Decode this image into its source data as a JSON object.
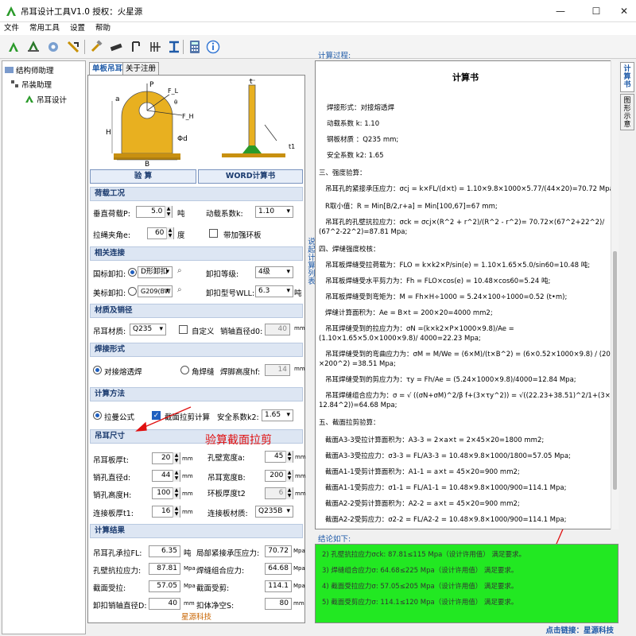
{
  "window": {
    "title": "吊耳设计工具V1.0 授权：火星源",
    "minimize": "—",
    "maximize": "☐",
    "close": "✕"
  },
  "menu": [
    "文件",
    "常用工具",
    "设置",
    "帮助"
  ],
  "tree": {
    "root": "结构师助理",
    "child": "吊装助理",
    "leaf": "吊耳设计"
  },
  "left_tabs": {
    "single": "单板吊耳",
    "about": "关于注册"
  },
  "buttons": {
    "check": "验    算",
    "word": "WORD计算书"
  },
  "diagram_labels": {
    "P": "P",
    "FL": "F_L",
    "FH": "F_H",
    "a": "a",
    "H": "H",
    "B": "B",
    "phi_d": "Φd",
    "t": "t",
    "t1": "t1",
    "theta": "θ"
  },
  "sections": {
    "load": "荷载工况",
    "connection": "相关连接",
    "material": "材质及销径",
    "weld": "焊接形式",
    "method": "计算方法",
    "size": "吊耳尺寸",
    "results": "计算结果"
  },
  "load": {
    "vertical_label": "垂直荷载P:",
    "vertical_value": "5.0",
    "vertical_unit": "吨",
    "dyn_label": "动载系数k:",
    "dyn_value": "1.10",
    "angle_label": "拉绳夹角e:",
    "angle_value": "60",
    "angle_unit": "度",
    "ring_label": "带加强环板"
  },
  "connection": {
    "national_label": "国标卸扣:",
    "national_value": "D形卸扣",
    "grade_label": "卸扣等级:",
    "grade_value": "4级",
    "american_label": "美标卸扣:",
    "american_value": "G209(BW",
    "model_label": "卸扣型号WLL:",
    "model_value": "6.3",
    "model_unit": "吨"
  },
  "material": {
    "steel_label": "吊耳材质:",
    "steel_value": "Q235",
    "custom_label": "自定义",
    "pin_label": "销轴直径d0:",
    "pin_value": "40",
    "pin_unit": "mm"
  },
  "weld": {
    "butt_label": "对接熔透焊",
    "fillet_label": "角焊缝",
    "height_label": "焊脚高度hf:",
    "height_value": "14",
    "unit": "mm"
  },
  "method": {
    "lame_label": "拉曼公式",
    "shear_label": "截面拉剪计算",
    "safety_label": "安全系数k2:",
    "safety_value": "1.65"
  },
  "size": {
    "t_label": "吊耳板厚t:",
    "t_value": "20",
    "a_label": "孔壁宽度a:",
    "a_value": "45",
    "d_label": "销孔直径d:",
    "d_value": "44",
    "b_label": "吊耳宽度B:",
    "b_value": "200",
    "h_label": "销孔高度H:",
    "h_value": "100",
    "t2_label": "环板厚度t2",
    "t2_value": "6",
    "t1_label": "连接板厚t1:",
    "t1_value": "16",
    "mat_label": "连接板材质:",
    "mat_value": "Q235B",
    "unit": "mm"
  },
  "results": {
    "fl_label": "吊耳孔承拉FL:",
    "fl_value": "6.35",
    "fl_unit": "吨",
    "cj_label": "局部紧接承压应力:",
    "cj_value": "70.72",
    "cj_unit": "Mpa",
    "ck_label": "孔壁抗拉应力:",
    "ck_value": "87.81",
    "ck_unit": "Mpa",
    "weld_label": "焊缝组合应力:",
    "weld_value": "64.68",
    "weld_unit": "Mpa",
    "sec_label": "截面受拉:",
    "sec_value": "57.05",
    "sec_unit": "Mpa",
    "shear_label": "截面受剪:",
    "shear_value": "114.1",
    "shear_unit": "Mpa",
    "pin_label": "卸扣销轴直径D:",
    "pin_value": "40",
    "pin_unit": "mm",
    "clear_label": "扣体净空S:",
    "clear_value": "80",
    "clear_unit": "mm"
  },
  "company": "星源科技",
  "annotation": "验算截面拉剪",
  "right": {
    "process_label": "计算过程:",
    "side_link": "说起计算列表",
    "vtab_calc": "计算书",
    "vtab_diagram": "图形示意",
    "calc_title": "计算书",
    "lines": [
      "焊接形式：对接熔透焊",
      "动载系数 k: 1.10",
      "钢板材质 ：Q235 mm;",
      "安全系数 k2: 1.65",
      "三、强度验算：",
      "吊耳孔的紧接承压应力：σcj = k×FL/(d×t) = 1.10×9.8×1000×5.77/(44×20)=70.72 Mpa",
      "R取小值：R = Min[B/2,r+a] = Min[100,67]=67 mm;",
      "吊耳孔的孔壁抗拉应力：σck = σcj×(R^2 + r^2)/(R^2 - r^2)= 70.72×(67^2+22^2)/",
      "(67^2-22^2)=87.81 Mpa;",
      "四、焊缝强度校核：",
      "吊耳板焊缝受拉荷载为：FLO = k×k2×P/sin(e) = 1.10×1.65×5.0/sin60=10.48 吨;",
      "吊耳板焊缝受水平剪力为：Fh = FLO×cos(e) = 10.48×cos60=5.24 吨;",
      "吊耳板焊缝受到弯矩为：M = Fh×H÷1000 = 5.24×100÷1000=0.52 (t•m);",
      "焊缝计算面积为：Ae = B×t = 200×20=4000 mm2;",
      "吊耳焊缝受到的拉应力为：σN =(k×k2×P×1000×9.8)/Ae =",
      "(1.10×1.65×5.0×1000×9.8)/ 4000=22.23 Mpa;",
      "吊耳焊缝受到的弯曲应力为：σM = M/We = (6×M)/(t×B^2) = (6×0.52×1000×9.8) / (20",
      "×200^2) =38.51 Mpa;",
      "吊耳焊缝受到的剪应力为：τy = Fh/Ae = (5.24×1000×9.8)/4000=12.84 Mpa;",
      "吊耳焊缝组合应力为：σ = √ ((σN+σM)^2/β f+(3×τy^2)) = √((22.23+38.51)^2/1+(3×",
      "12.84^2))=64.68 Mpa;",
      "五、截面拉剪验算：",
      "截面A3-3受拉计算面积为：A3-3 = 2×a×t = 2×45×20=1800 mm2;",
      "截面A3-3受拉应力：σ3-3 = FL/A3-3 = 10.48×9.8×1000/1800=57.05 Mpa;",
      "截面A1-1受剪计算面积为：A1-1 = a×t = 45×20=900 mm2;",
      "截面A1-1受剪应力：σ1-1 = FL/A1-1 = 10.48×9.8×1000/900=114.1 Mpa;",
      "截面A2-2受剪计算面积为：A2-2 = a×t = 45×20=900 mm2;",
      "截面A2-2受剪应力：σ2-2 = FL/A2-2 = 10.48×9.8×1000/900=114.1 Mpa;"
    ],
    "conclusion_label": "结论如下:",
    "conclusions": [
      "2) 孔壁抗拉应力σck: 87.81≤115 Mpa（设计许用值） 满足要求。",
      "3) 焊缝组合应力σ: 64.68≤225 Mpa（设计许用值） 满足要求。",
      "4) 截面受拉应力σ: 57.05≤205 Mpa（设计许用值） 满足要求。",
      "5) 截面受剪应力σ: 114.1≤120 Mpa（设计许用值） 满足要求。"
    ],
    "footer_link": "点击链接：星源科技"
  }
}
